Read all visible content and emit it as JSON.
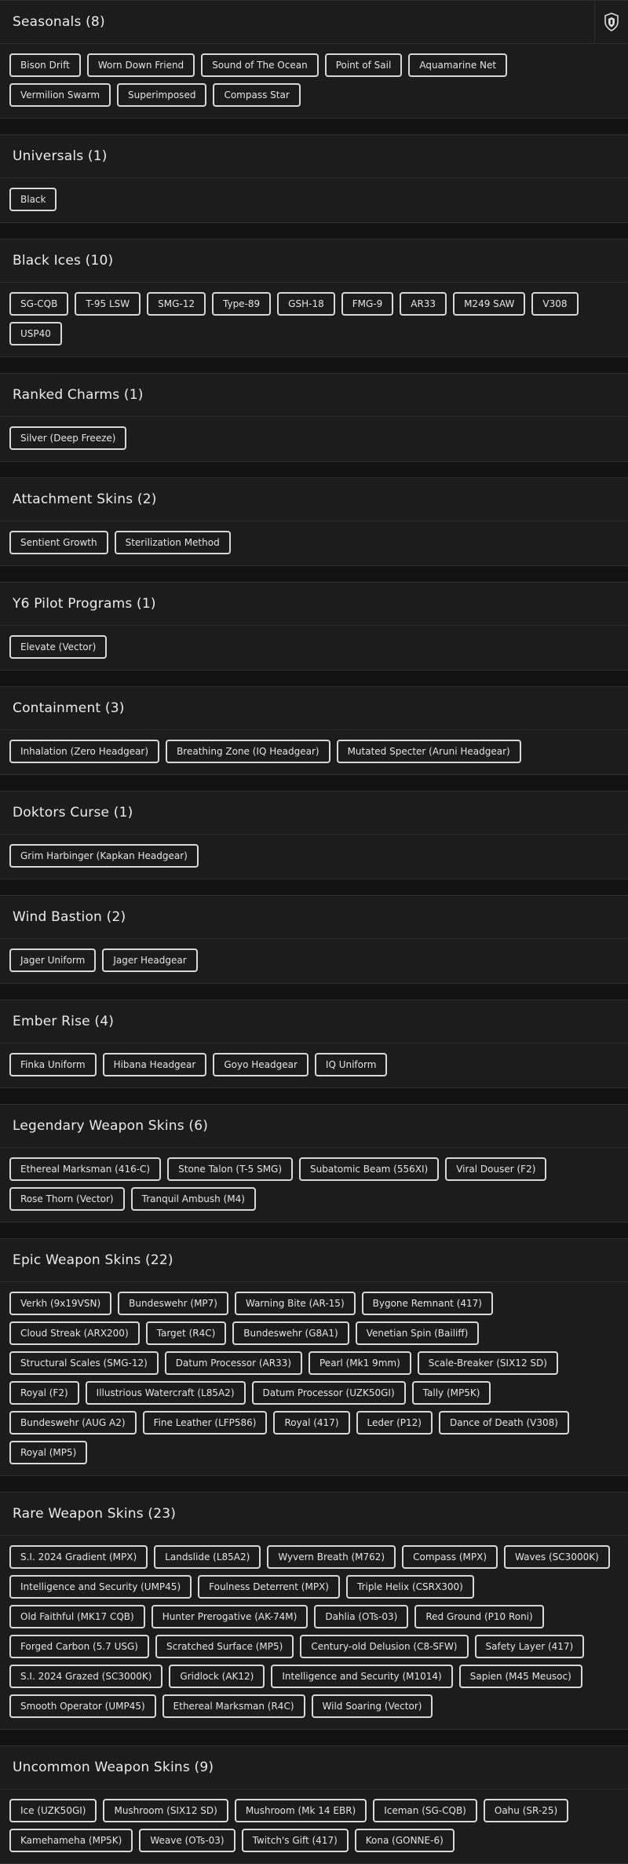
{
  "sections": [
    {
      "title": "Seasonals (8)",
      "tags": [
        "Bison Drift",
        "Worn Down Friend",
        "Sound of The Ocean",
        "Point of Sail",
        "Aquamarine Net",
        "Vermilion Swarm",
        "Superimposed",
        "Compass Star"
      ]
    },
    {
      "title": "Universals (1)",
      "tags": [
        "Black"
      ]
    },
    {
      "title": "Black Ices (10)",
      "tags": [
        "SG-CQB",
        "T-95 LSW",
        "SMG-12",
        "Type-89",
        "GSH-18",
        "FMG-9",
        "AR33",
        "M249 SAW",
        "V308",
        "USP40"
      ]
    },
    {
      "title": "Ranked Charms (1)",
      "tags": [
        "Silver (Deep Freeze)"
      ]
    },
    {
      "title": "Attachment Skins (2)",
      "tags": [
        "Sentient Growth",
        "Sterilization Method"
      ]
    },
    {
      "title": "Y6 Pilot Programs (1)",
      "tags": [
        "Elevate (Vector)"
      ]
    },
    {
      "title": "Containment (3)",
      "tags": [
        "Inhalation (Zero Headgear)",
        "Breathing Zone (IQ Headgear)",
        "Mutated Specter (Aruni Headgear)"
      ]
    },
    {
      "title": "Doktors Curse (1)",
      "tags": [
        "Grim Harbinger (Kapkan Headgear)"
      ]
    },
    {
      "title": "Wind Bastion (2)",
      "tags": [
        "Jager Uniform",
        "Jager Headgear"
      ]
    },
    {
      "title": "Ember Rise (4)",
      "tags": [
        "Finka Uniform",
        "Hibana Headgear",
        "Goyo Headgear",
        "IQ Uniform"
      ]
    },
    {
      "title": "Legendary Weapon Skins (6)",
      "tags": [
        "Ethereal Marksman (416-C)",
        "Stone Talon (T-5 SMG)",
        "Subatomic Beam (556XI)",
        "Viral Douser (F2)",
        "Rose Thorn (Vector)",
        "Tranquil Ambush (M4)"
      ]
    },
    {
      "title": "Epic Weapon Skins (22)",
      "tags": [
        "Verkh (9x19VSN)",
        "Bundeswehr (MP7)",
        "Warning Bite (AR-15)",
        "Bygone Remnant (417)",
        "Cloud Streak (ARX200)",
        "Target (R4C)",
        "Bundeswehr (G8A1)",
        "Venetian Spin (Bailiff)",
        "Structural Scales (SMG-12)",
        "Datum Processor (AR33)",
        "Pearl (Mk1 9mm)",
        "Scale-Breaker (SIX12 SD)",
        "Royal (F2)",
        "Illustrious Watercraft (L85A2)",
        "Datum Processor (UZK50GI)",
        "Tally (MP5K)",
        "Bundeswehr (AUG A2)",
        "Fine Leather (LFP586)",
        "Royal (417)",
        "Leder (P12)",
        "Dance of Death (V308)",
        "Royal (MP5)"
      ]
    },
    {
      "title": "Rare Weapon Skins (23)",
      "tags": [
        "S.I. 2024 Gradient (MPX)",
        "Landslide (L85A2)",
        "Wyvern Breath (M762)",
        "Compass (MPX)",
        "Waves (SC3000K)",
        "Intelligence and Security (UMP45)",
        "Foulness Deterrent (MPX)",
        "Triple Helix (CSRX300)",
        "Old Faithful (MK17 CQB)",
        "Hunter Prerogative (AK-74M)",
        "Dahlia (OTs-03)",
        "Red Ground (P10 Roni)",
        "Forged Carbon (5.7 USG)",
        "Scratched Surface (MP5)",
        "Century-old Delusion (C8-SFW)",
        "Safety Layer (417)",
        "S.I. 2024 Grazed (SC3000K)",
        "Gridlock (AK12)",
        "Intelligence and Security (M1014)",
        "Sapien (M45 Meusoc)",
        "Smooth Operator (UMP45)",
        "Ethereal Marksman (R4C)",
        "Wild Soaring (Vector)"
      ]
    },
    {
      "title": "Uncommon Weapon Skins (9)",
      "tags": [
        "Ice (UZK50GI)",
        "Mushroom (SIX12 SD)",
        "Mushroom (Mk 14 EBR)",
        "Iceman (SG-CQB)",
        "Oahu (SR-25)",
        "Kamehameha (MP5K)",
        "Weave (OTs-03)",
        "Twitch's Gift (417)",
        "Kona (GONNE-6)"
      ]
    }
  ],
  "corner_icon": "badge-icon",
  "colors": {
    "background": "#121212",
    "panel": "#1c1c1c",
    "border": "#2e2e2e",
    "tag_border": "#d8d8d8",
    "text": "#e6e6e6"
  }
}
